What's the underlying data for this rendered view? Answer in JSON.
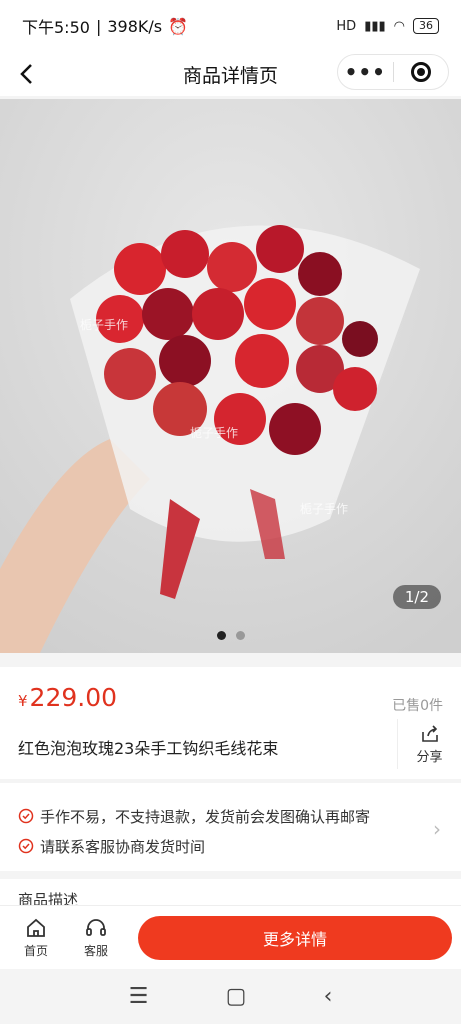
{
  "status_bar": {
    "time": "下午5:50",
    "speed": "398K/s",
    "signal": "HD",
    "battery": "36"
  },
  "nav": {
    "title": "商品详情页",
    "more": "•••"
  },
  "gallery": {
    "indicator": "1/2",
    "watermark": "栀子手作"
  },
  "product": {
    "price_symbol": "¥",
    "price": "229.00",
    "sold": "已售0件",
    "title": "红色泡泡玫瑰23朵手工钩织毛线花束",
    "share_label": "分享"
  },
  "notices": [
    "手作不易，不支持退款，发货前会发图确认再邮寄",
    "请联系客服协商发货时间"
  ],
  "description_header": "商品描述",
  "action_bar": {
    "home": "首页",
    "service": "客服",
    "primary": "更多详情"
  },
  "colors": {
    "accent": "#ef3a1f",
    "price": "#e0321e"
  },
  "icons": {
    "back": "chevron-left-icon",
    "more": "more-icon",
    "close": "target-icon",
    "share": "share-icon",
    "check": "check-circle-icon",
    "home": "home-icon",
    "service": "headset-icon"
  }
}
